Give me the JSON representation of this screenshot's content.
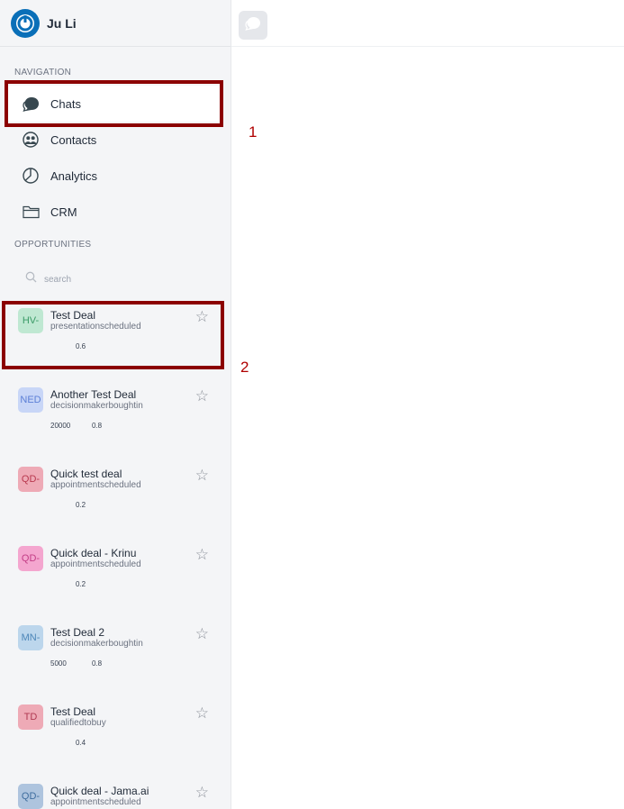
{
  "user": {
    "name": "Ju Li"
  },
  "sections": {
    "navigation": "NAVIGATION",
    "opportunities": "OPPORTUNITIES"
  },
  "nav": [
    {
      "label": "Chats",
      "icon": "chat-icon",
      "active": true
    },
    {
      "label": "Contacts",
      "icon": "contacts-icon",
      "active": false
    },
    {
      "label": "Analytics",
      "icon": "pie-chart-icon",
      "active": false
    },
    {
      "label": "CRM",
      "icon": "folder-icon",
      "active": false
    }
  ],
  "search": {
    "placeholder": "search",
    "value": ""
  },
  "deals": [
    {
      "initials": "HV-",
      "name": "Test Deal",
      "stage": "presentationscheduled",
      "amount": "",
      "probability": "0.6",
      "avatar_bg": "#bfe8d2",
      "avatar_fg": "#3a9a66"
    },
    {
      "initials": "NED",
      "name": "Another Test Deal",
      "stage": "decisionmakerboughtin",
      "amount": "20000",
      "probability": "0.8",
      "avatar_bg": "#c8d6f7",
      "avatar_fg": "#5b7fd6"
    },
    {
      "initials": "QD-",
      "name": "Quick test deal",
      "stage": "appointmentscheduled",
      "amount": "",
      "probability": "0.2",
      "avatar_bg": "#eeaab6",
      "avatar_fg": "#b8384e"
    },
    {
      "initials": "QD-",
      "name": "Quick deal - Krinu",
      "stage": "appointmentscheduled",
      "amount": "",
      "probability": "0.2",
      "avatar_bg": "#f4a6cf",
      "avatar_fg": "#c33d86"
    },
    {
      "initials": "MN-",
      "name": "Test Deal 2",
      "stage": "decisionmakerboughtin",
      "amount": "5000",
      "probability": "0.8",
      "avatar_bg": "#bcd6ec",
      "avatar_fg": "#4c86b8"
    },
    {
      "initials": "TD",
      "name": "Test Deal",
      "stage": "qualifiedtobuy",
      "amount": "",
      "probability": "0.4",
      "avatar_bg": "#eeaab6",
      "avatar_fg": "#b03a52"
    },
    {
      "initials": "QD-",
      "name": "Quick deal - Jama.ai",
      "stage": "appointmentscheduled",
      "amount": "",
      "probability": "",
      "avatar_bg": "#aec4de",
      "avatar_fg": "#3f6d9e"
    }
  ],
  "annotations": {
    "marker_1": "1",
    "marker_2": "2"
  },
  "colors": {
    "highlight": "#8b0000",
    "marker": "#b00000",
    "logo": "#0a6fb8"
  }
}
